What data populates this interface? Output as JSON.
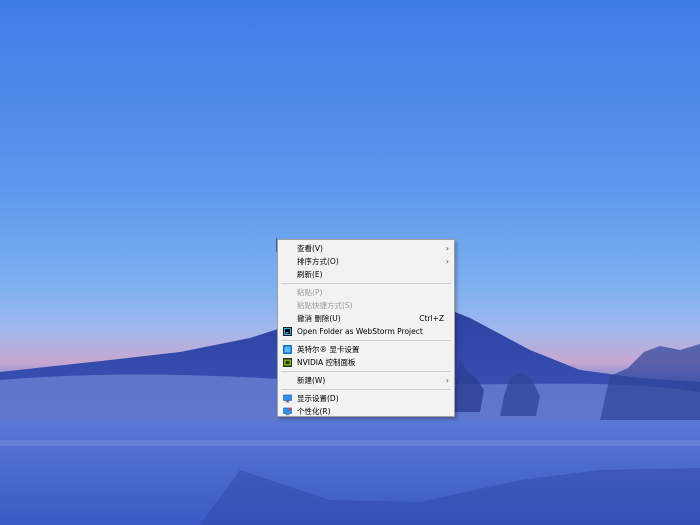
{
  "context_menu": {
    "items": [
      {
        "label": "查看(V)",
        "submenu": true
      },
      {
        "label": "排序方式(O)",
        "submenu": true
      },
      {
        "label": "刷新(E)"
      },
      {
        "label": "粘贴(P)",
        "disabled": true
      },
      {
        "label": "粘贴快捷方式(S)",
        "disabled": true
      },
      {
        "label": "撤消 删除(U)",
        "shortcut": "Ctrl+Z"
      },
      {
        "label": "Open Folder as WebStorm Project",
        "icon": "webstorm-icon"
      },
      {
        "label": "英特尔® 显卡设置",
        "icon": "intel-graphics-icon"
      },
      {
        "label": "NVIDIA 控制面板",
        "icon": "nvidia-icon"
      },
      {
        "label": "新建(W)",
        "submenu": true
      },
      {
        "label": "显示设置(D)",
        "icon": "display-settings-icon"
      },
      {
        "label": "个性化(R)",
        "icon": "personalize-icon"
      }
    ]
  },
  "colors": {
    "menu_bg": "#f2f2f2",
    "menu_border": "#a0a0a0",
    "disabled_text": "#9a9a9a"
  }
}
